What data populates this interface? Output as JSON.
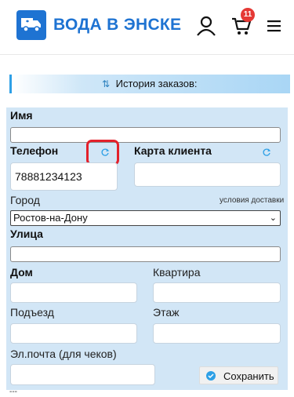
{
  "header": {
    "brand": "ВОДА В ЭНСКЕ",
    "cart_count": "11",
    "icons": [
      "truck-logo-icon",
      "user-icon",
      "cart-icon",
      "menu-icon"
    ]
  },
  "history": {
    "label": "История заказов:"
  },
  "form": {
    "name_label": "Имя",
    "name_value": "",
    "phone_label": "Телефон",
    "phone_value": "78881234123",
    "card_label": "Карта клиента",
    "card_value": "",
    "city_label": "Город",
    "delivery_link": "условия доставки",
    "city_value": "Ростов-на-Дону",
    "street_label": "Улица",
    "street_value": "",
    "house_label": "Дом",
    "house_value": "",
    "apt_label": "Квартира",
    "apt_value": "",
    "entrance_label": "Подъезд",
    "entrance_value": "",
    "floor_label": "Этаж",
    "floor_value": "",
    "email_label": "Эл.почта (для чеков)",
    "email_value": "",
    "save_label": "Сохранить"
  },
  "footer": {
    "dashes": "---"
  },
  "colors": {
    "brand": "#1e73d2",
    "panel": "#d2e6f6",
    "badge": "#e53935",
    "highlight": "#e3212b"
  }
}
